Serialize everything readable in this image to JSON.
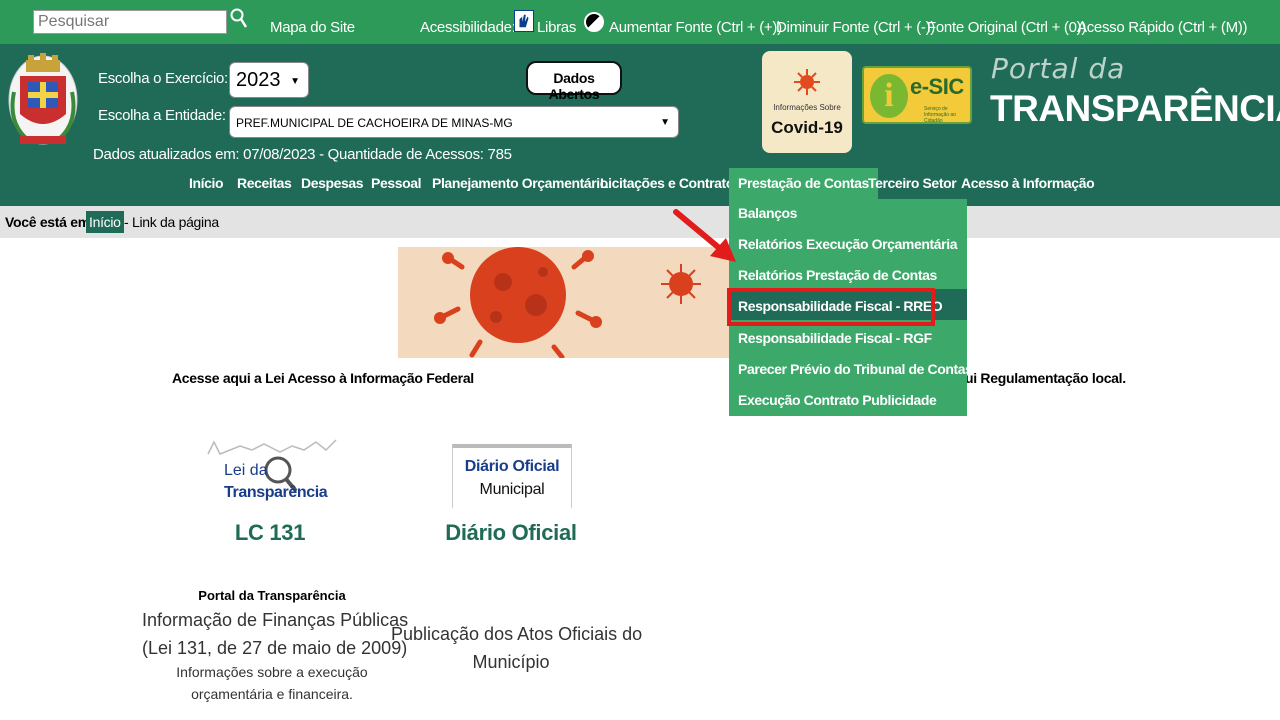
{
  "topbar": {
    "search_placeholder": "Pesquisar",
    "sitemap": "Mapa do Site",
    "accessibility_label": "Acessibilidade:",
    "libras": "Libras",
    "increase_font": "Aumentar Fonte (Ctrl + (+))",
    "decrease_font": "Diminuir Fonte (Ctrl + (-))",
    "original_font": "Fonte Original (Ctrl + (0))",
    "quick_access": "Acesso Rápido (Ctrl + (M))"
  },
  "header": {
    "year_label": "Escolha o Exercício:",
    "year_value": "2023",
    "entity_label": "Escolha a Entidade:",
    "entity_value": "PREF.MUNICIPAL DE CACHOEIRA DE MINAS-MG",
    "open_data_button": "Dados Abertos",
    "status": "Dados atualizados em: 07/08/2023 - Quantidade de Acessos: 785",
    "covid_sub": "Informações Sobre",
    "covid_main": "Covid-19",
    "esic_main": "e-SIC",
    "esic_sub": "Serviço de Informação ao Cidadão",
    "portal_small": "Portal da",
    "portal_big": "TRANSPARÊNCIA"
  },
  "nav": [
    "Início",
    "Receitas",
    "Despesas",
    "Pessoal",
    "Planejamento Orçamentário",
    "Licitações e Contratos",
    "Prestação de Contas",
    "Terceiro Setor",
    "Acesso à Informação"
  ],
  "breadcrumb": {
    "label": "Você está em:",
    "home": "Início",
    "rest": "- Link da página"
  },
  "dropdown": [
    "Balanços",
    "Relatórios Execução Orçamentária",
    "Relatórios Prestação de Contas",
    "Responsabilidade Fiscal - RREO",
    "Responsabilidade Fiscal - RGF",
    "Parecer Prévio do Tribunal de Contas",
    "Execução Contrato Publicidade"
  ],
  "notices": {
    "left": "Acesse aqui a Lei Acesso à Informação Federal",
    "right": "ui Regulamentação local."
  },
  "cards": {
    "lei_logo_l1": "Lei da",
    "lei_logo_l2": "Transparência",
    "lc_title": "LC 131",
    "lc_heading": "Portal da Transparência",
    "lc_line1": "Informação de Finanças Públicas",
    "lc_line2": "(Lei 131, de 27 de maio de 2009)",
    "lc_line3": "Informações sobre a execução",
    "lc_line4": "orçamentária e financeira.",
    "diario_logo_l1": "Diário Oficial",
    "diario_logo_l2": "Municipal",
    "diario_title": "Diário Oficial",
    "diario_line1": "Publicação dos Atos Oficiais do",
    "diario_line2": "Município"
  },
  "colors": {
    "topbar_green": "#2e9a5a",
    "header_green": "#1f6b57",
    "menu_green": "#3ca86a",
    "highlight_red": "#e21b1b"
  }
}
